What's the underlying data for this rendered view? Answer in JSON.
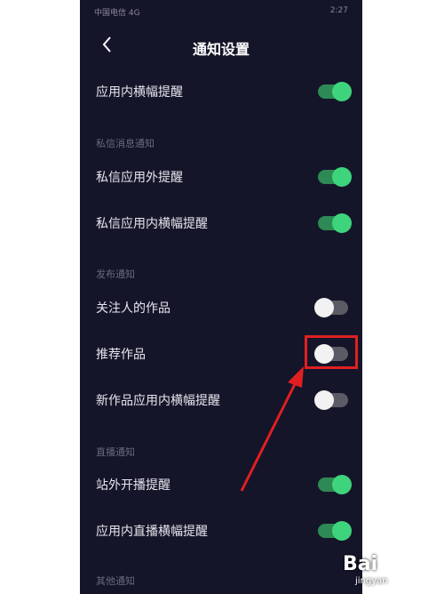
{
  "status_bar": {
    "carrier": "中国电信 4G",
    "time": "2:27"
  },
  "header": {
    "title": "通知设置"
  },
  "rows": [
    {
      "type": "item",
      "label": "应用内横幅提醒",
      "on": true
    },
    {
      "type": "section",
      "label": "私信消息通知"
    },
    {
      "type": "item",
      "label": "私信应用外提醒",
      "on": true
    },
    {
      "type": "item",
      "label": "私信应用内横幅提醒",
      "on": true
    },
    {
      "type": "section",
      "label": "发布通知"
    },
    {
      "type": "item",
      "label": "关注人的作品",
      "on": false
    },
    {
      "type": "item",
      "label": "推荐作品",
      "on": false
    },
    {
      "type": "item",
      "label": "新作品应用内横幅提醒",
      "on": false
    },
    {
      "type": "section",
      "label": "直播通知"
    },
    {
      "type": "item",
      "label": "站外开播提醒",
      "on": true
    },
    {
      "type": "item",
      "label": "应用内直播横幅提醒",
      "on": true
    },
    {
      "type": "section",
      "label": "其他通知"
    }
  ],
  "colors": {
    "toggle_on": "#3ed47c",
    "toggle_off": "#f2f2f2",
    "highlight": "#e02020"
  },
  "watermark": {
    "text": "Bai",
    "sub": "jingyan"
  }
}
